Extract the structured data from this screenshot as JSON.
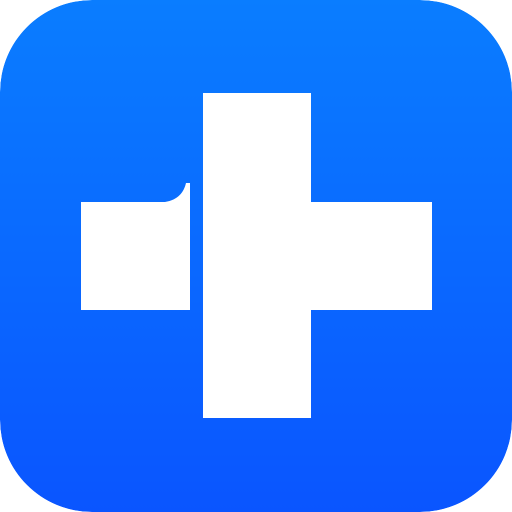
{
  "icon": {
    "name": "medical-cross-app-icon",
    "gradient_top": "#0a7dff",
    "gradient_bottom": "#0a55ff",
    "glyph_color": "#ffffff"
  }
}
